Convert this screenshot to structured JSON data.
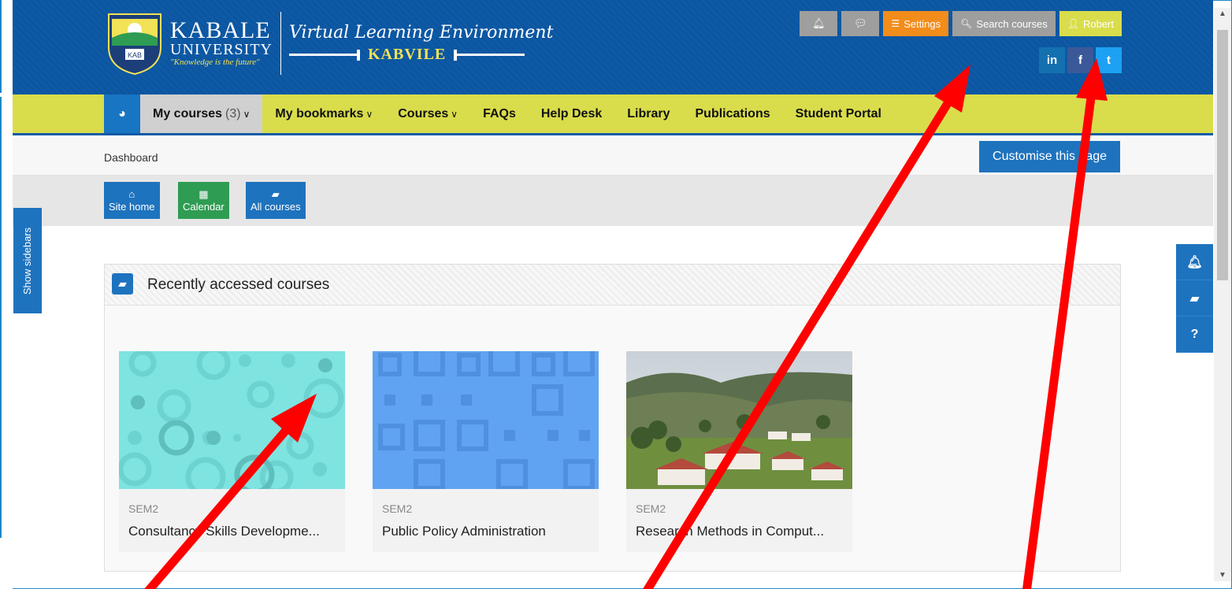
{
  "header": {
    "university_name": "KABALE",
    "university_sub": "UNIVERSITY",
    "motto": "\"Knowledge is the future\"",
    "vle_title": "Virtual Learning Environment",
    "vle_short": "KABVILE",
    "crest_text": "KAB",
    "buttons": {
      "notifications_icon": "bell-icon",
      "messages_icon": "chat-bubble-icon",
      "settings_label": "Settings",
      "search_label": "Search courses",
      "user_label": "Robert"
    },
    "social": {
      "linkedin": "in",
      "facebook": "f",
      "twitter": "t"
    }
  },
  "colors": {
    "header_blue": "#0e5aa5",
    "nav_yellow": "#d9dd4b",
    "accent_blue": "#1e73be",
    "settings_orange": "#f28c1b",
    "calendar_green": "#2e9c52",
    "annotation_red": "#ff0000"
  },
  "nav": {
    "items": [
      {
        "label": "My courses",
        "count": "(3)",
        "chevron": "∨"
      },
      {
        "label": "My bookmarks",
        "chevron": "∨"
      },
      {
        "label": "Courses",
        "chevron": "∨"
      },
      {
        "label": "FAQs"
      },
      {
        "label": "Help Desk"
      },
      {
        "label": "Library"
      },
      {
        "label": "Publications"
      },
      {
        "label": "Student Portal"
      }
    ]
  },
  "breadcrumb": "Dashboard",
  "customise_label": "Customise this page",
  "quicklinks": [
    {
      "label": "Site home",
      "icon": "home-icon"
    },
    {
      "label": "Calendar",
      "icon": "calendar-icon"
    },
    {
      "label": "All courses",
      "icon": "book-icon"
    }
  ],
  "show_sidebars_label": "Show sidebars",
  "right_float": [
    {
      "icon": "bell-icon"
    },
    {
      "icon": "book-icon"
    },
    {
      "icon": "question-icon",
      "glyph": "?"
    }
  ],
  "block": {
    "title": "Recently accessed courses",
    "courses": [
      {
        "category": "SEM2",
        "name": "Consultancy Skills Developme..."
      },
      {
        "category": "SEM2",
        "name": "Public Policy Administration"
      },
      {
        "category": "SEM2",
        "name": "Research Methods in Comput..."
      }
    ]
  }
}
